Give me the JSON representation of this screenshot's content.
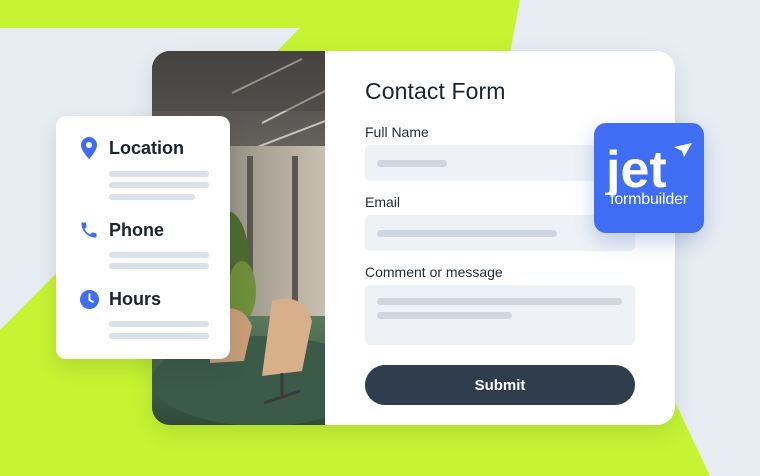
{
  "colors": {
    "background": "#c6f432",
    "accent_shape": "#e8edf3",
    "button": "#2f3d4d",
    "icon_blue": "#3f6ef5",
    "logo_bg": "#3f6ef5"
  },
  "info_card": {
    "items": [
      {
        "icon": "location-pin-icon",
        "label": "Location"
      },
      {
        "icon": "phone-icon",
        "label": "Phone"
      },
      {
        "icon": "clock-icon",
        "label": "Hours"
      }
    ]
  },
  "form": {
    "title": "Contact Form",
    "fields": [
      {
        "label": "Full Name"
      },
      {
        "label": "Email"
      },
      {
        "label": "Comment or message"
      }
    ],
    "submit_label": "Submit"
  },
  "logo": {
    "brand": "jet",
    "subtitle": "formbuilder"
  }
}
